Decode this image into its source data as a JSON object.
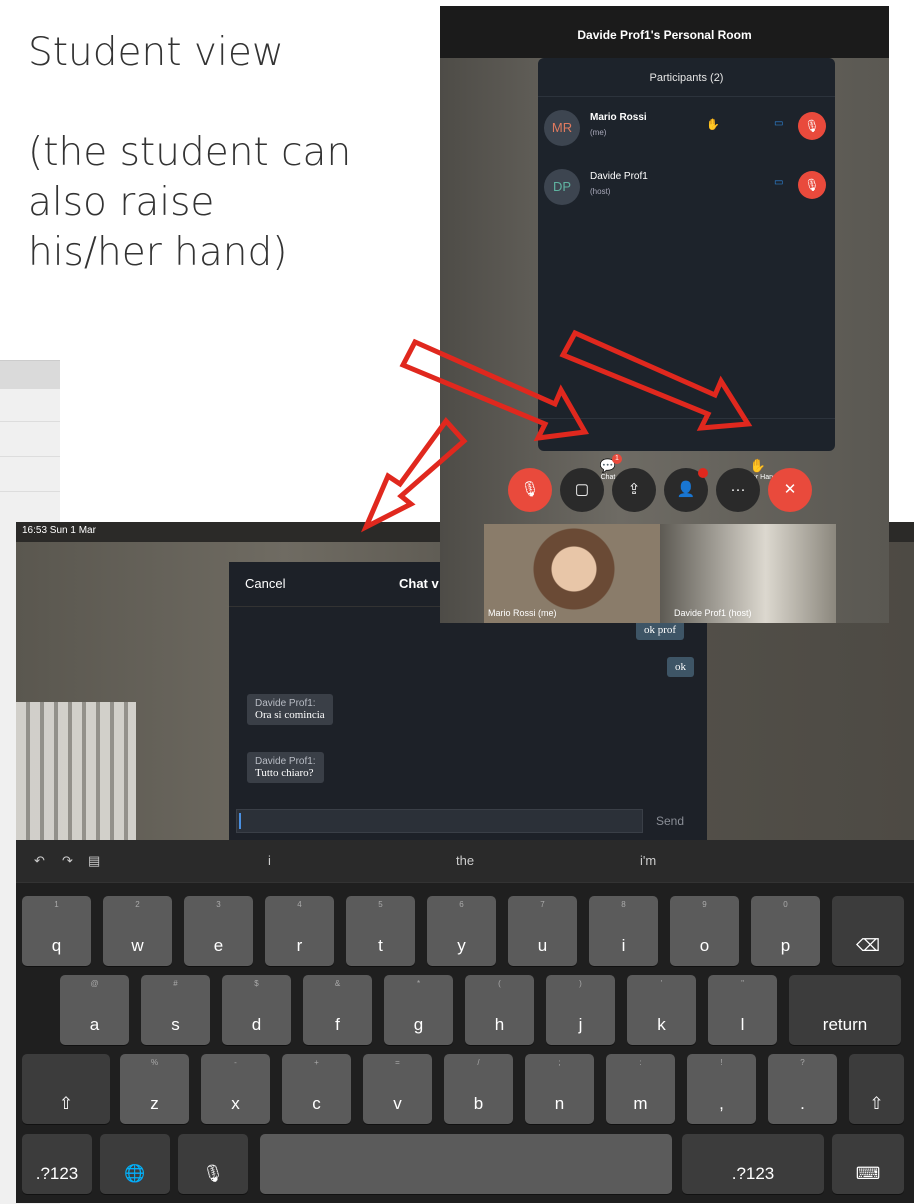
{
  "caption": {
    "line1": "Student view",
    "line2": "(the student can",
    "line3": "also raise",
    "line4": "his/her hand)"
  },
  "ipad": {
    "status_time": "16:53  Sun 1 Mar",
    "chat": {
      "cancel": "Cancel",
      "title": "Chat v",
      "messages_out": [
        "ok prof",
        "ok"
      ],
      "messages_in": [
        {
          "sender": "Davide Prof1:",
          "text": "Ora si comincia"
        },
        {
          "sender": "Davide Prof1:",
          "text": "Tutto chiaro?"
        }
      ],
      "send": "Send"
    },
    "suggestions": [
      "i",
      "the",
      "i'm"
    ],
    "keyboard": {
      "row1": [
        [
          "1",
          "q"
        ],
        [
          "2",
          "w"
        ],
        [
          "3",
          "e"
        ],
        [
          "4",
          "r"
        ],
        [
          "5",
          "t"
        ],
        [
          "6",
          "y"
        ],
        [
          "7",
          "u"
        ],
        [
          "8",
          "i"
        ],
        [
          "9",
          "o"
        ],
        [
          "0",
          "p"
        ]
      ],
      "row2": [
        [
          "@",
          "a"
        ],
        [
          "#",
          "s"
        ],
        [
          "$",
          "d"
        ],
        [
          "&",
          "f"
        ],
        [
          "*",
          "g"
        ],
        [
          "(",
          "h"
        ],
        [
          ")",
          "j"
        ],
        [
          "'",
          "k"
        ],
        [
          "\"",
          "l"
        ]
      ],
      "row3": [
        [
          "%",
          "z"
        ],
        [
          "-",
          "x"
        ],
        [
          "+",
          "c"
        ],
        [
          "=",
          "v"
        ],
        [
          "/",
          "b"
        ],
        [
          ";",
          "n"
        ],
        [
          ":",
          "m"
        ],
        [
          "!",
          ","
        ],
        [
          "?",
          "."
        ]
      ],
      "return": "return",
      "numbers": ".?123",
      "delete_icon": "⌫",
      "shift_icon": "⇧",
      "globe_icon": "🌐",
      "mic_icon": "🎙",
      "keyboard_icon": "⌨"
    }
  },
  "webex": {
    "room_title": "Davide Prof1's Personal Room",
    "participants_title": "Participants (2)",
    "participants": [
      {
        "initials": "MR",
        "name": "Mario Rossi",
        "role": "(me)"
      },
      {
        "initials": "DP",
        "name": "Davide Prof1",
        "role": "(host)"
      }
    ],
    "chat_tab": "Chat",
    "lower_hand_tab": "Lower Hand",
    "chat_badge": "1",
    "thumb_labels": [
      "Mario Rossi (me)",
      "Davide Prof1 (host)"
    ]
  },
  "colors": {
    "arrow": "#e0281e",
    "mute_red": "#e94a3c",
    "video_blue": "#2f8ae0"
  }
}
